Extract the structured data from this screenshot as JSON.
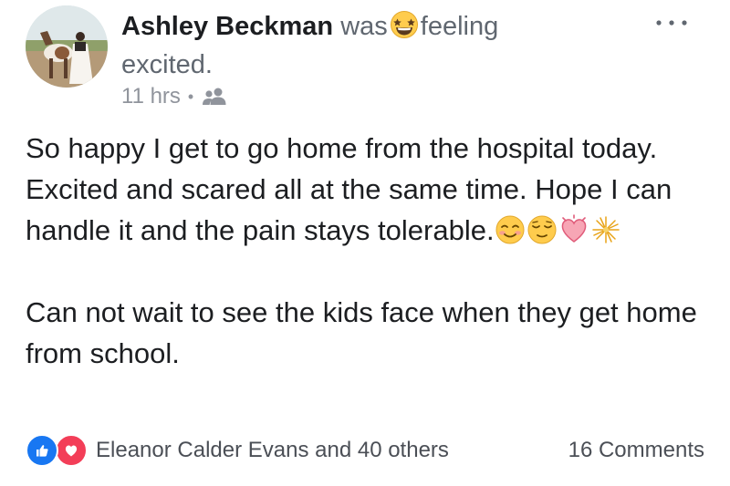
{
  "post": {
    "author": "Ashley Beckman",
    "activity_verb": "was",
    "activity_text": "feeling",
    "feeling": "excited.",
    "feeling_icon": "star-struck-emoji-icon",
    "timestamp": "11 hrs",
    "separator": "•",
    "audience_icon": "friends-icon",
    "body_paragraph_1": "So happy I get to go home from the hospital today. Excited and scared all at the same time. Hope I can handle it and the pain stays tolerable.",
    "body_paragraph_1_emojis": [
      "smiling-face-icon",
      "relieved-face-icon",
      "beating-heart-icon",
      "sparkler-icon"
    ],
    "body_paragraph_2": "Can not wait to see the kids face when they get home from school."
  },
  "footer": {
    "reaction_icons": [
      "like-icon",
      "love-icon"
    ],
    "reactors_text": "Eleanor Calder Evans and 40 others",
    "comments_text": "16 Comments"
  },
  "colors": {
    "text_primary": "#1c1e21",
    "text_secondary": "#606770",
    "meta_gray": "#90949c",
    "like_blue": "#1877f2",
    "love_red": "#f33e58",
    "emoji_yellow": "#ffcc4d"
  }
}
